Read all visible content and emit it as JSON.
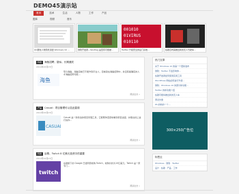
{
  "site": {
    "title": "DEMO45演示站"
  },
  "nav": {
    "items": [
      "首页",
      "技术",
      "生活",
      "人物",
      "工作",
      "产品"
    ]
  },
  "subnav": {
    "items": [
      "图库",
      "视频",
      "音乐"
    ]
  },
  "ticker": [
    {
      "caption": "QQ群友人物到处讲述 Windows 10 ..."
    },
    {
      "caption": "微软开发者—Skulltag 是否有可能被..."
    },
    {
      "caption": "Twitter 升级安全的后门系统..."
    },
    {
      "caption": "谷歌宣布其推出新的无人驾驶车..."
    }
  ],
  "posts": [
    {
      "badge": "科技",
      "title": "海鱼招聘，疑似，长期通关",
      "date": "2014年03月07日",
      "excerpt": "现今海鱼，海鱼目前已不能作到平台人，目前就在海鱼招聘中，并且有着确实的人才海鱼招聘可能...",
      "readmore": "阅读全文 »"
    },
    {
      "badge": "产品",
      "title": "Casual：项目管理可以如此直观",
      "date": "2014年03月07日",
      "excerpt": "Casual 是一款简洁的项目管理工具，它能帮你直观地看到项目进度，并能在线上进行协作...",
      "readmore": "阅读全文 »"
    },
    {
      "badge": "科技",
      "title": "谷歌、Twitch 8 亿美元投资中的重要",
      "date": "2014年03月07日",
      "excerpt": "谷歌旗下的 Google 已经同意收购 Twitch，收购价约为10亿美元，Twitch 是一家专门...",
      "readmore": "阅读全文 »"
    }
  ],
  "sidebar": {
    "recent_title": "热门文章",
    "recent_items": [
      "关于 Windows 10 的第一个更新发布",
      "微软：Twitter 不会影响你...",
      "谷歌开发者如何使用实用工具",
      "WordPress 网站如何进行升级...",
      "微软：Windows 10 的部分新功能...",
      "Twitter 的新功能介绍",
      "谷歌可能将推出新的无人车",
      "测试文章",
      "PS 的新的一个..."
    ],
    "ad_text": "300×250广告位",
    "tags_title": "标签云",
    "tag_items": [
      "Windows · 微软 · Twitter",
      "设计 · 谷歌 · 产品 · 工作"
    ]
  }
}
